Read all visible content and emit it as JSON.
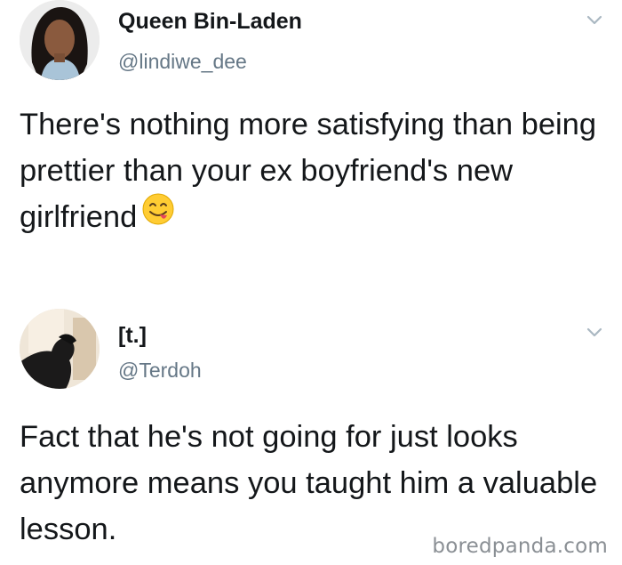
{
  "tweets": [
    {
      "display_name": "Queen Bin-Laden",
      "handle": "@lindiwe_dee",
      "text": "There's nothing more satisfying than being prettier than your ex boyfriend's new girlfriend",
      "emoji": "face-savoring-food-emoji",
      "menu_icon": "chevron-down-icon"
    },
    {
      "display_name": "[t.]",
      "handle": "@Terdoh",
      "text": "Fact that he's not going for just looks anymore means you taught him a valuable lesson.",
      "menu_icon": "chevron-down-icon"
    }
  ],
  "watermark": "boredpanda.com",
  "colors": {
    "text": "#14171a",
    "handle": "#657786",
    "chevron": "#aab8c2",
    "watermark": "#8a8f94"
  }
}
